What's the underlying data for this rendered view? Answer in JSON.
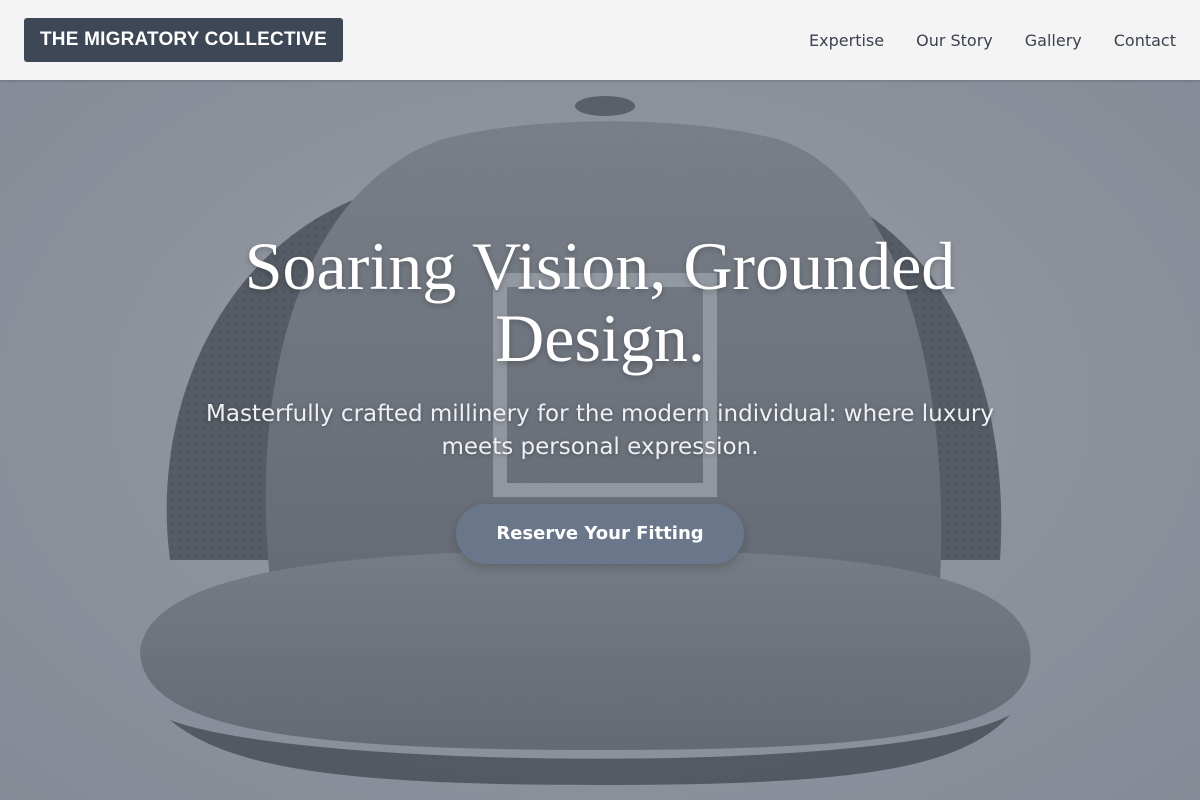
{
  "header": {
    "brand": "THE MIGRATORY COLLECTIVE",
    "nav": [
      {
        "label": "Expertise"
      },
      {
        "label": "Our Story"
      },
      {
        "label": "Gallery"
      },
      {
        "label": "Contact"
      }
    ]
  },
  "hero": {
    "title": "Soaring Vision, Grounded Design.",
    "subtitle": "Masterfully crafted millinery for the modern individual: where luxury meets personal expression.",
    "cta_label": "Reserve Your Fitting",
    "image_subject": "grey-snapback-cap-photo"
  },
  "colors": {
    "header_bg": "#f4f4f4",
    "brand_bg": "#3e4756",
    "nav_text": "#3a4150",
    "cta_bg": "#6a7689",
    "hero_bg": "#9499a3"
  }
}
